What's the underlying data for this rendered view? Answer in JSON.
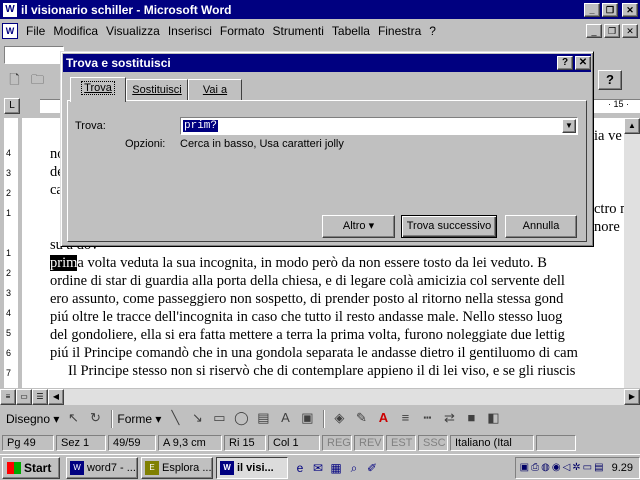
{
  "window": {
    "title": "il visionario schiller - Microsoft Word",
    "app_icon": "W",
    "controls": [
      "_",
      "❐",
      "✕"
    ]
  },
  "menu": {
    "items": [
      "File",
      "Modifica",
      "Visualizza",
      "Inserisci",
      "Formato",
      "Strumenti",
      "Tabella",
      "Finestra",
      "?"
    ],
    "doc_controls": [
      "_",
      "❐",
      "✕"
    ]
  },
  "ruler": {
    "right_number": "· 15 ·"
  },
  "vruler_numbers": [
    "4",
    "3",
    "2",
    "1",
    "1",
    "2",
    "3",
    "4",
    "5",
    "6",
    "7",
    "8",
    "9",
    "10"
  ],
  "document": {
    "lines": [
      {
        "pre": "",
        "hl": "",
        "text": "no                                                                                               ! Un"
      },
      {
        "pre": "",
        "hl": "",
        "text": "de                                                                                          ecoml"
      },
      {
        "pre": "",
        "hl": "",
        "text": "ca"
      },
      {
        "pre": "",
        "hl": "",
        "text": "su                                                                                              a dov"
      },
      {
        "pre": "",
        "hl": "prim",
        "text": "a volta veduta la sua incognita, in modo però da non essere tosto da lei veduto. B"
      },
      {
        "pre": "",
        "hl": "",
        "text": "ordine di star di guardia alla porta della chiesa, e di legare colà amicizia col servente dell"
      },
      {
        "pre": "",
        "hl": "",
        "text": "ero assunto, come passeggiero non sospetto, di prender posto al ritorno nella stessa gond"
      },
      {
        "pre": "",
        "hl": "",
        "text": "piú oltre le tracce dell'incognita in caso che tutto il resto andasse male. Nello stesso luog"
      },
      {
        "pre": "",
        "hl": "",
        "text": "del gondoliere, ella si era fatta mettere a terra la prima volta, furono noleggiate due lettig"
      },
      {
        "pre": "",
        "hl": "",
        "text": "piú il Principe comandò che in una gondola separata le andasse dietro il gentiluomo di cam"
      },
      {
        "pre": "    ",
        "hl": "",
        "text": "Il Principe stesso non si riservò che di contemplare appieno il di lei viso, e se gli riuscis"
      }
    ],
    "right_fragments": [
      "ia ve",
      "ctro n",
      "nore"
    ]
  },
  "drawbar": {
    "disegno": "Disegno ▾",
    "forme": "Forme ▾"
  },
  "status": {
    "cells": [
      "Pg 49",
      "Sez 1",
      "49/59",
      "A  9,3 cm",
      "Ri 15",
      "Col 1"
    ],
    "modes": [
      "REG",
      "REV",
      "EST",
      "SSC"
    ],
    "language": "Italiano (Ital"
  },
  "taskbar": {
    "start": "Start",
    "tasks": [
      "word7 - ...",
      "Esplora ...",
      "il visi..."
    ],
    "clock": "9.29"
  },
  "dialog": {
    "title": "Trova e sostituisci",
    "tabs": [
      "Trova",
      "Sostituisci",
      "Vai a"
    ],
    "find_label": "Trova:",
    "find_value": "prim?",
    "options_label": "Opzioni:",
    "options_value": "Cerca in basso, Usa caratteri jolly",
    "buttons": {
      "altro": "Altro ▾",
      "trova_successivo": "Trova successivo",
      "annulla": "Annulla"
    }
  },
  "colors": {
    "titlebar": "#000080",
    "face": "#c0c0c0",
    "selection": "#000080"
  }
}
